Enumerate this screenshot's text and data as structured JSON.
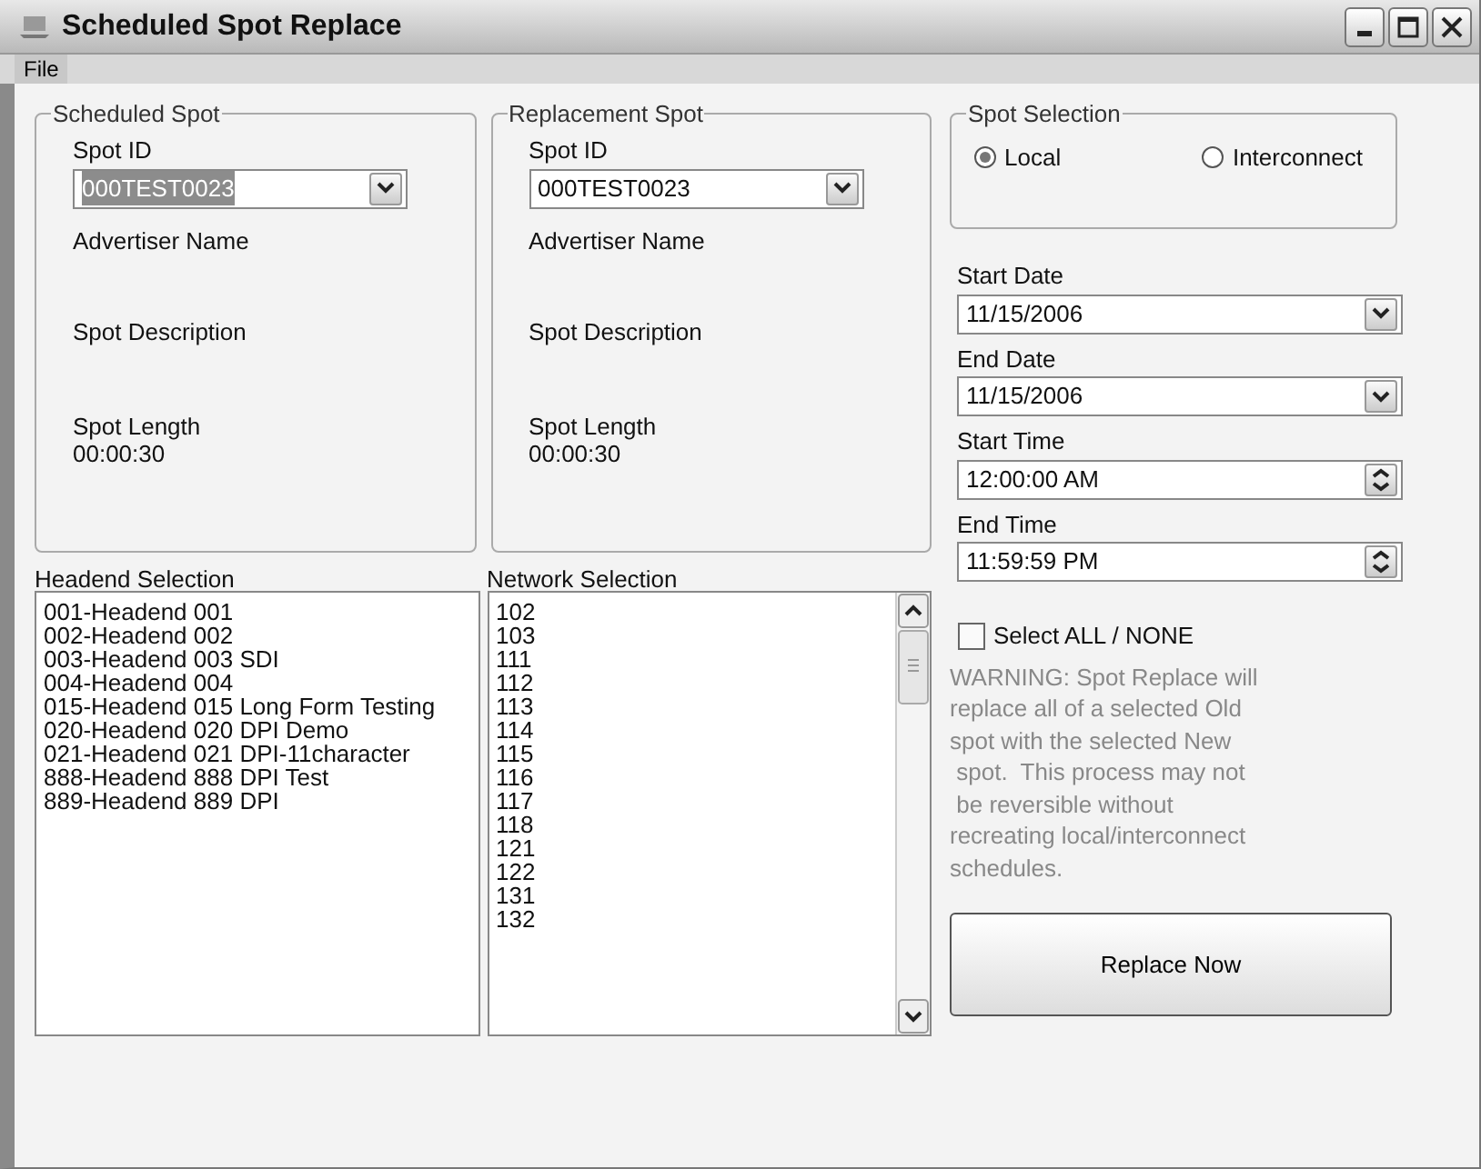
{
  "window": {
    "title": "Scheduled Spot Replace"
  },
  "menu": [
    {
      "label": "File"
    }
  ],
  "scheduled_spot": {
    "title": "Scheduled Spot",
    "spot_id_label": "Spot ID",
    "spot_id": "000TEST0023",
    "text_selected": true,
    "advertiser_label": "Advertiser Name",
    "description_label": "Spot Description",
    "length_label": "Spot Length",
    "length": "00:00:30"
  },
  "replacement_spot": {
    "title": "Replacement Spot",
    "spot_id_label": "Spot ID",
    "spot_id": "000TEST0023",
    "text_selected": false,
    "advertiser_label": "Advertiser Name",
    "description_label": "Spot Description",
    "length_label": "Spot Length",
    "length": "00:00:30"
  },
  "spot_selection": {
    "title": "Spot Selection",
    "options": [
      {
        "label": "Local",
        "selected": true
      },
      {
        "label": "Interconnect",
        "selected": false
      }
    ]
  },
  "date_time_fields": [
    {
      "label": "Start Date",
      "value": "11/15/2006",
      "kind": "date"
    },
    {
      "label": "End Date",
      "value": "11/15/2006",
      "kind": "date"
    },
    {
      "label": "Start Time",
      "value": "12:00:00 AM",
      "kind": "time"
    },
    {
      "label": "End Time",
      "value": "11:59:59 PM",
      "kind": "time"
    }
  ],
  "headend_selection": {
    "label": "Headend Selection",
    "items": [
      "001-Headend 001",
      "002-Headend 002",
      "003-Headend 003 SDI",
      "004-Headend 004",
      "015-Headend 015 Long Form Testing",
      "020-Headend 020 DPI Demo",
      "021-Headend 021 DPI-11character",
      "888-Headend 888 DPI Test",
      "889-Headend 889 DPI"
    ]
  },
  "network_selection": {
    "label": "Network Selection",
    "items": [
      "102",
      "103",
      "111",
      "112",
      "113",
      "114",
      "115",
      "116",
      "117",
      "118",
      "121",
      "122",
      "131",
      "132"
    ]
  },
  "select_all": {
    "label": "Select ALL / NONE",
    "checked": false
  },
  "warning": "WARNING: Spot Replace will\nreplace all of a selected Old\nspot with the selected New\n spot.  This process may not\n be reversible without\nrecreating local/interconnect\nschedules.",
  "replace_button": "Replace Now"
}
